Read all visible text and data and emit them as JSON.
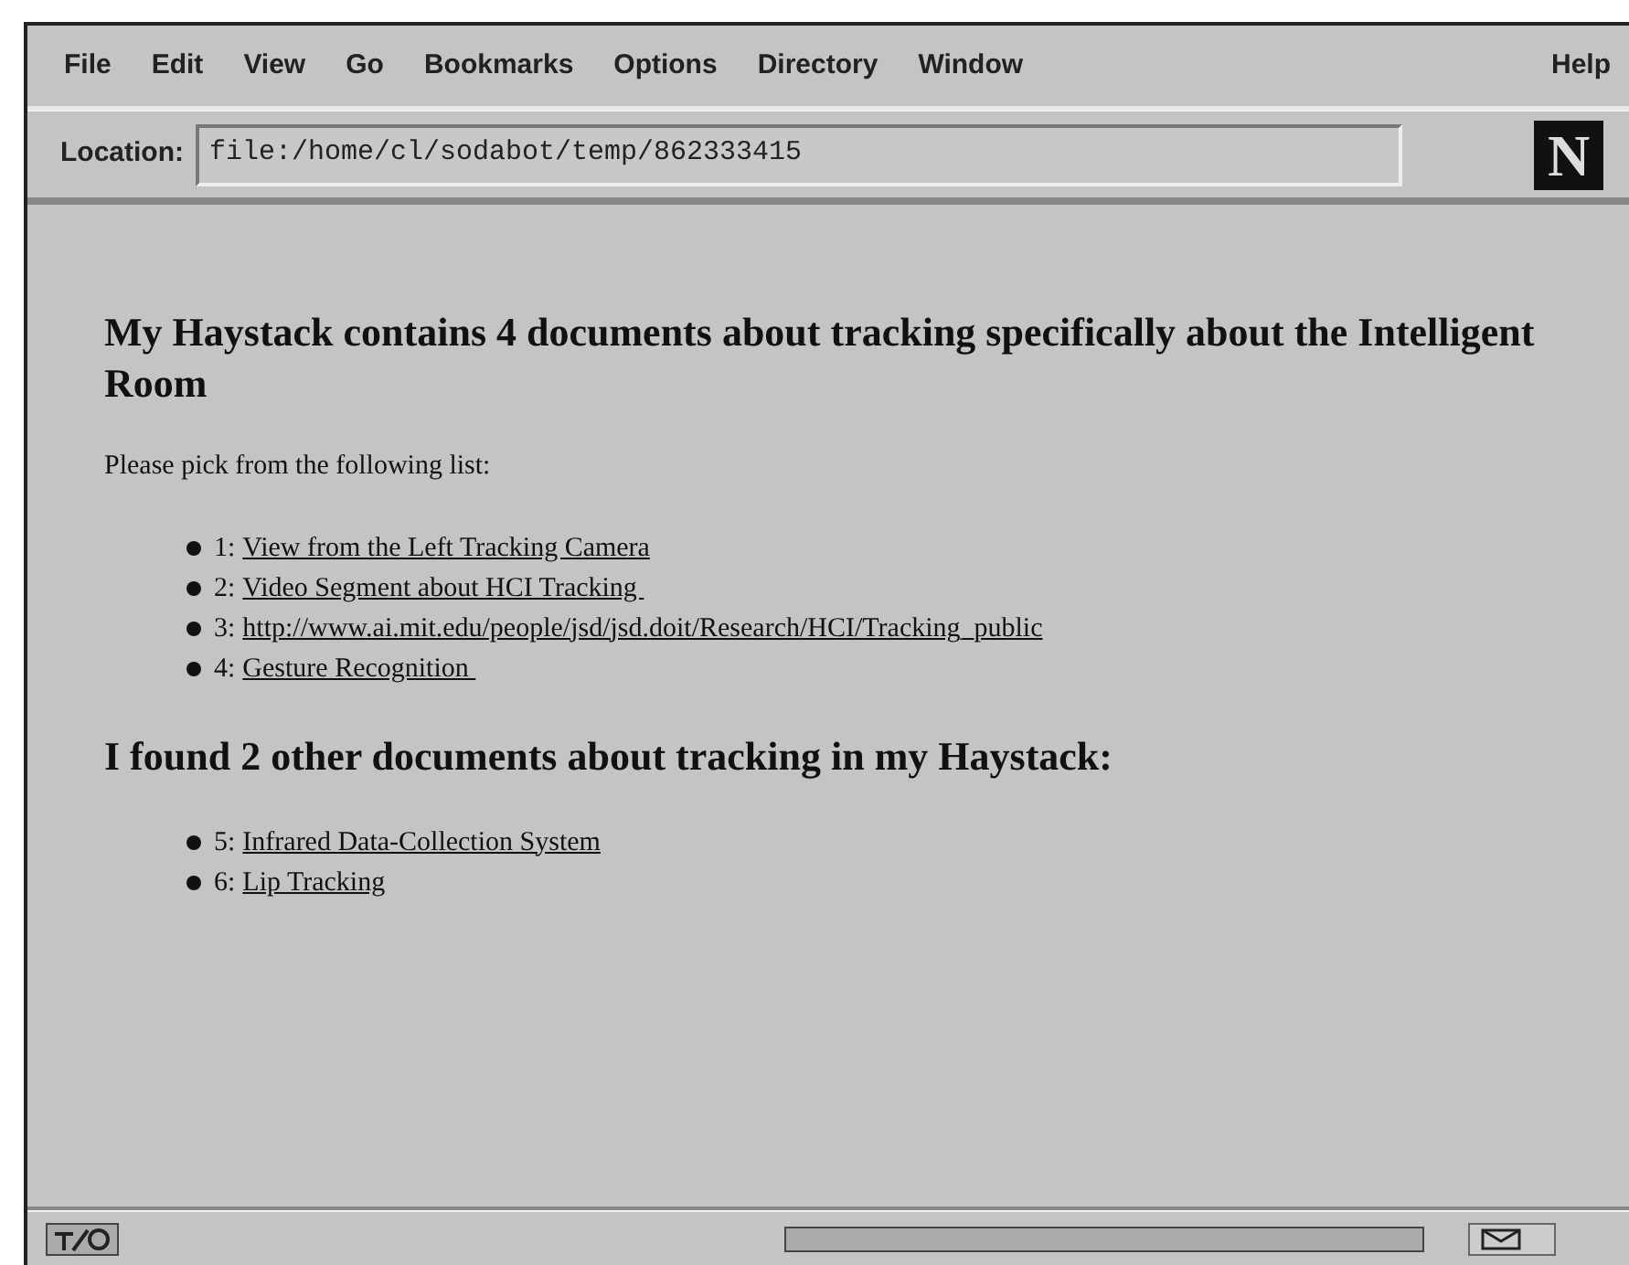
{
  "menu_bar": [
    "File",
    "Edit",
    "View",
    "Go",
    "Bookmarks",
    "Options",
    "Directory",
    "Window",
    "Help"
  ],
  "location": {
    "label": "Location:",
    "value": "file:/home/cl/sodabot/temp/862333415"
  },
  "logo": "N",
  "page": {
    "heading": "My Haystack contains 4 documents about tracking specifically about the Intelligent Room",
    "intro": "Please pick from the following list:",
    "list": [
      {
        "number": "1:",
        "link": "View from the Left Tracking Camera"
      },
      {
        "number": "2:",
        "link": "Video Segment about HCI Tracking "
      },
      {
        "number": "3:",
        "link": "http://www.ai.mit.edu/people/jsd/jsd.doit/Research/HCI/Tracking_public"
      },
      {
        "number": "4:",
        "link": "Gesture Recognition "
      }
    ],
    "heading_2": "I found 2 other documents about tracking in my Haystack:",
    "list_2": [
      {
        "number": "5:",
        "link": "Infrared Data-Collection System"
      },
      {
        "number": "6:",
        "link": "Lip Tracking"
      }
    ]
  }
}
